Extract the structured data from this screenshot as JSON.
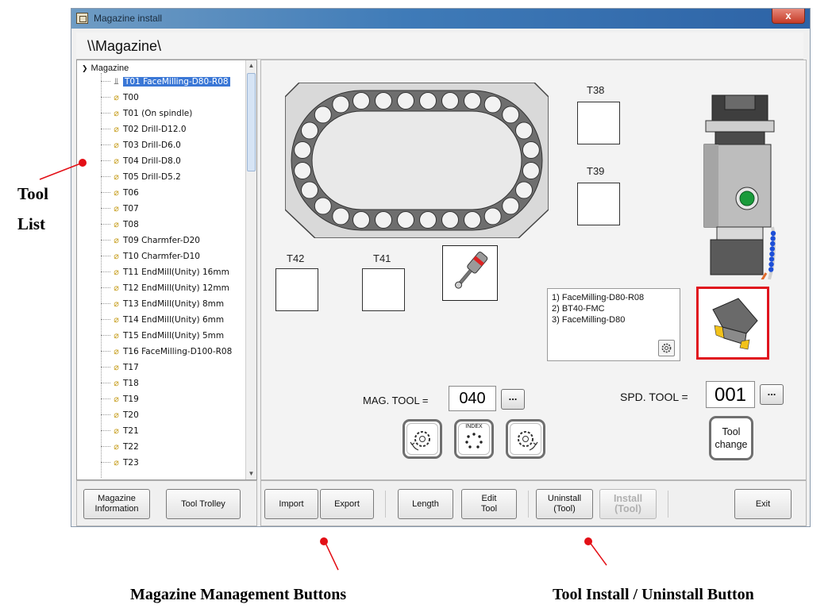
{
  "window": {
    "title": "Magazine install",
    "close_label": "x",
    "path": "\\\\Magazine\\"
  },
  "tree": {
    "root_label": "Magazine",
    "items": [
      {
        "label": "T01 FaceMilling-D80-R08",
        "selected": true,
        "icon": "spindle-icon"
      },
      {
        "label": "T00",
        "icon": "tool-icon"
      },
      {
        "label": "T01 (On spindle)",
        "icon": "tool-icon"
      },
      {
        "label": "T02 Drill-D12.0",
        "icon": "tool-icon"
      },
      {
        "label": "T03 Drill-D6.0",
        "icon": "tool-icon"
      },
      {
        "label": "T04 Drill-D8.0",
        "icon": "tool-icon"
      },
      {
        "label": "T05 Drill-D5.2",
        "icon": "tool-icon"
      },
      {
        "label": "T06",
        "icon": "tool-icon"
      },
      {
        "label": "T07",
        "icon": "tool-icon"
      },
      {
        "label": "T08",
        "icon": "tool-icon"
      },
      {
        "label": "T09 Charmfer-D20",
        "icon": "tool-icon"
      },
      {
        "label": "T10 Charmfer-D10",
        "icon": "tool-icon"
      },
      {
        "label": "T11 EndMill(Unity) 16mm",
        "icon": "tool-icon"
      },
      {
        "label": "T12 EndMill(Unity) 12mm",
        "icon": "tool-icon"
      },
      {
        "label": "T13 EndMill(Unity) 8mm",
        "icon": "tool-icon"
      },
      {
        "label": "T14 EndMill(Unity) 6mm",
        "icon": "tool-icon"
      },
      {
        "label": "T15 EndMill(Unity) 5mm",
        "icon": "tool-icon"
      },
      {
        "label": "T16 FaceMilling-D100-R08",
        "icon": "tool-icon"
      },
      {
        "label": "T17",
        "icon": "tool-icon"
      },
      {
        "label": "T18",
        "icon": "tool-icon"
      },
      {
        "label": "T19",
        "icon": "tool-icon"
      },
      {
        "label": "T20",
        "icon": "tool-icon"
      },
      {
        "label": "T21",
        "icon": "tool-icon"
      },
      {
        "label": "T22",
        "icon": "tool-icon"
      },
      {
        "label": "T23",
        "icon": "tool-icon"
      }
    ]
  },
  "slots": {
    "t38": "T38",
    "t39": "T39",
    "t42": "T42",
    "t41": "T41"
  },
  "tool_info": {
    "lines": [
      "1) FaceMilling-D80-R08",
      "2) BT40-FMC",
      "3) FaceMilling-D80"
    ]
  },
  "mag_tool": {
    "label": "MAG. TOOL =",
    "value": "040",
    "dots": "..."
  },
  "spd_tool": {
    "label": "SPD. TOOL =",
    "value": "001",
    "dots": "..."
  },
  "controls": {
    "index_label": "INDEX",
    "tool_change_label": "Tool\nchange"
  },
  "left_toolbar": {
    "magazine_info": "Magazine\nInformation",
    "tool_trolley": "Tool Trolley"
  },
  "main_toolbar": {
    "import": "Import",
    "export": "Export",
    "length": "Length",
    "edit_tool": "Edit\nTool",
    "uninstall": "Uninstall\n(Tool)",
    "install": "Install\n(Tool)",
    "exit": "Exit"
  },
  "annotations": {
    "tool_list_1": "Tool",
    "tool_list_2": "List",
    "magazine_buttons": "Magazine Management Buttons",
    "install_button": "Tool Install / Uninstall Button",
    "dot_color": "#e30f16"
  },
  "colors": {
    "highlight_box": "#e0141e",
    "selection": "#3a77d6",
    "gear_green": "#1a9b3b"
  }
}
